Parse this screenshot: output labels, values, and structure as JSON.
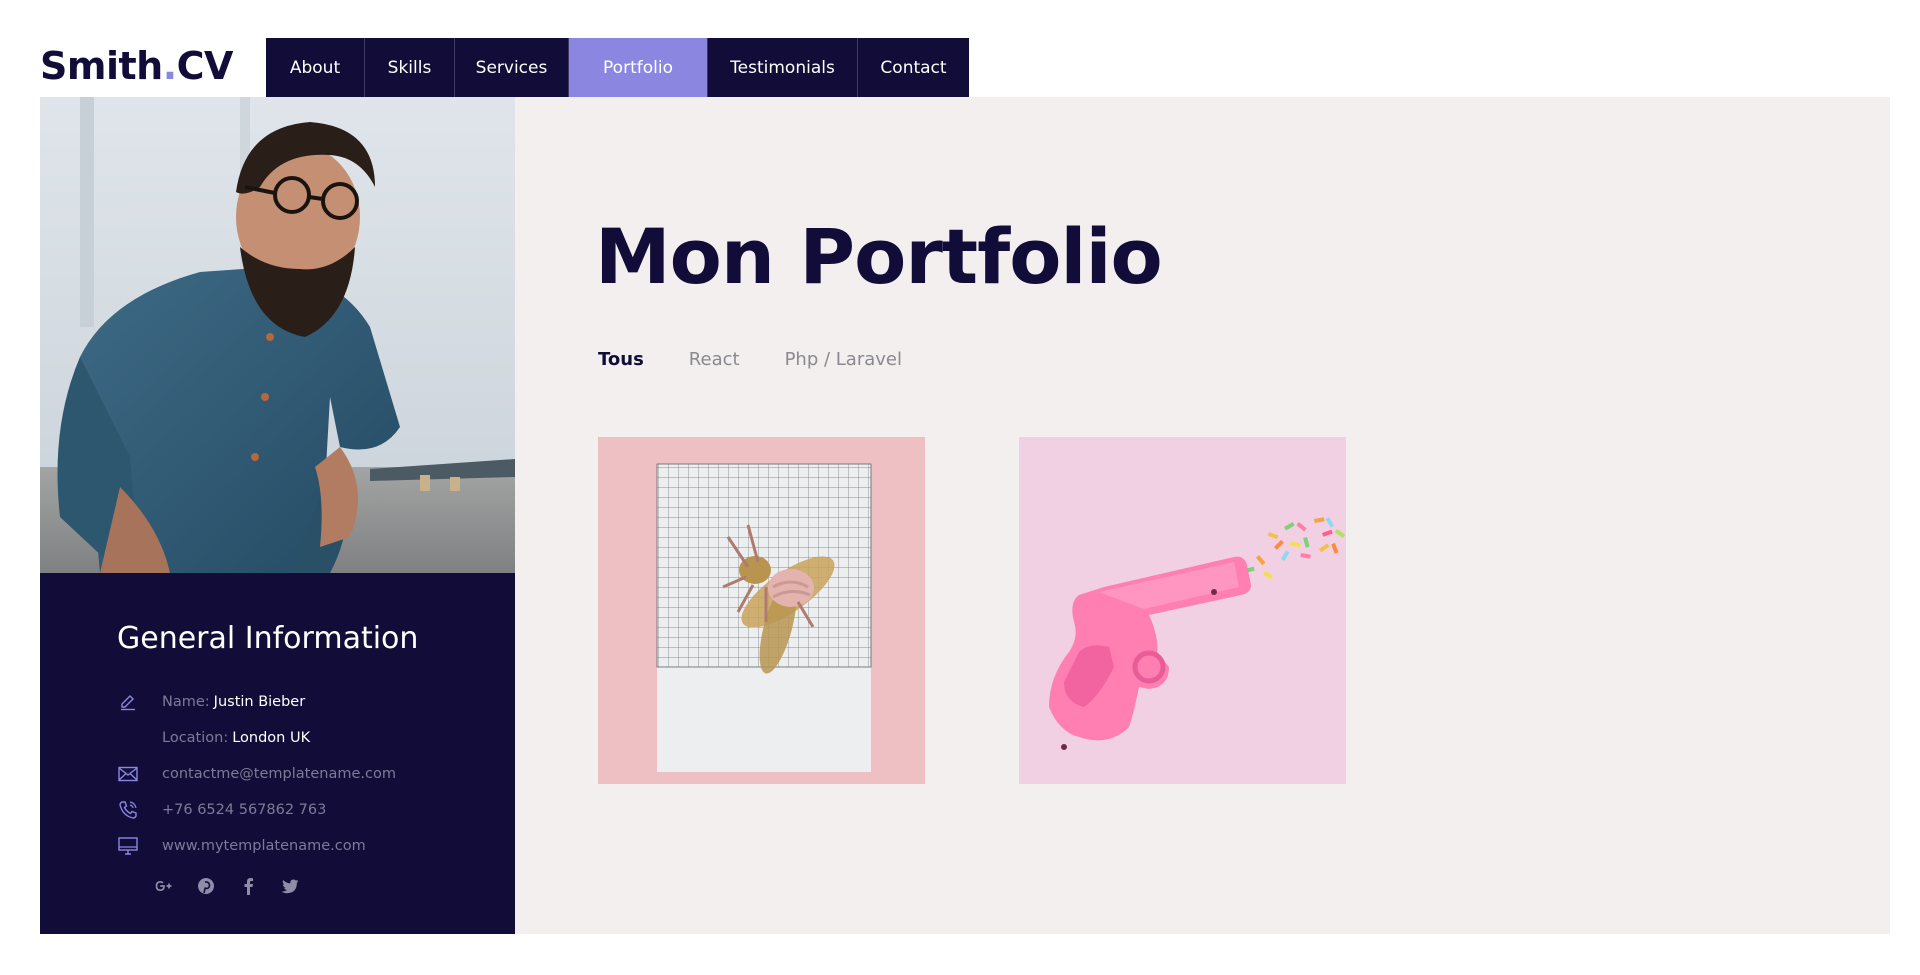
{
  "header": {
    "logo_main": "Smith",
    "logo_dot": ".",
    "logo_suffix": "CV",
    "nav": [
      {
        "label": "About"
      },
      {
        "label": "Skills"
      },
      {
        "label": "Services"
      },
      {
        "label": "Portfolio",
        "active": true
      },
      {
        "label": "Testimonials"
      },
      {
        "label": "Contact"
      }
    ]
  },
  "sidebar": {
    "title": "General Information",
    "name_label": "Name:",
    "name_value": "Justin Bieber",
    "location_label": "Location:",
    "location_value": "London UK",
    "email": "contactme@templatename.com",
    "phone": "+76 6524 567862 763",
    "website": "www.mytemplatename.com",
    "socials": [
      "google-plus-icon",
      "pinterest-icon",
      "facebook-icon",
      "twitter-icon"
    ]
  },
  "main": {
    "title": "Mon Portfolio",
    "filters": [
      {
        "label": "Tous",
        "active": true
      },
      {
        "label": "React"
      },
      {
        "label": "Php / Laravel"
      }
    ],
    "items": [
      "golden-bee-on-grid-paper",
      "pink-toy-gun-with-sprinkles"
    ]
  },
  "colors": {
    "navy": "#110d38",
    "accent": "#8b87e0",
    "panel_bg": "#f3efef"
  }
}
